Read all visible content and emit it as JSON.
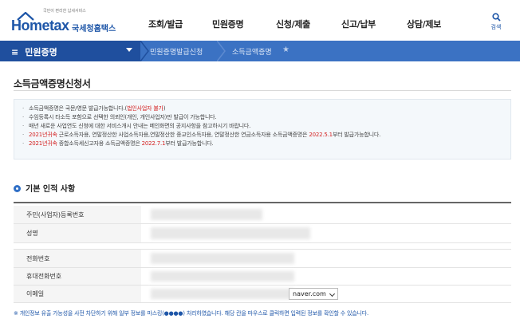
{
  "header": {
    "logo_tagline": "국민이 편리한 납세서비스",
    "logo_text": "Hometax",
    "logo_kname": "국세청홈택스",
    "menu": [
      "조회/발급",
      "민원증명",
      "신청/제출",
      "신고/납부",
      "상담/제보"
    ],
    "search_label": "검색"
  },
  "nav": {
    "menu_label": "민원증명",
    "breadcrumbs": [
      "민원증명발급신청",
      "소득금액증명"
    ]
  },
  "page": {
    "title": "소득금액증명신청서"
  },
  "notice": {
    "line1_a": "소득금액증명은 국문/영문 발급가능합니다.(",
    "line1_b": "법인사업자 불가",
    "line1_c": ")",
    "line2": "수임등록시 타소득 포함으로 선택한 의뢰인(개인, 개인사업자)만 발급이 가능합니다.",
    "line3": "매년 새로운 사업연도 신청에 대한 서비스개시 안내는 메인화면의 공지사항을 참고하시기 바랍니다.",
    "line4_a": "2021년귀속",
    "line4_b": " 근로소득자용, 연말정산한 사업소득자용,연말정산한 종교인소득자용, 연말정산한 연금소득자용 소득금액증명은 ",
    "line4_c": "2022.5.1",
    "line4_d": "부터 발급가능합니다.",
    "line5_a": "2021년귀속",
    "line5_b": " 종합소득세신고자용 소득금액증명은 ",
    "line5_c": "2022.7.1",
    "line5_d": "부터 발급가능합니다."
  },
  "section": {
    "title": "기본 인적 사항",
    "fields": [
      "주민(사업자)등록번호",
      "성명",
      "전화번호",
      "휴대전화번호",
      "이메일"
    ]
  },
  "email": {
    "domain_selected": "naver.com"
  },
  "footer_note": "※ 개인정보 유출 가능성을 사전 차단하기 위해 일부 정보를 마스킹(●●●●) 처리하였습니다. 해당 칸을 마우스로 클릭하면 입력된 정보를 확인할 수 있습니다.",
  "colors": {
    "brand_blue": "#1e56a8",
    "nav_blue": "#3b72c3",
    "nav_dark": "#1f4f9e",
    "alert_red": "#d42020"
  }
}
